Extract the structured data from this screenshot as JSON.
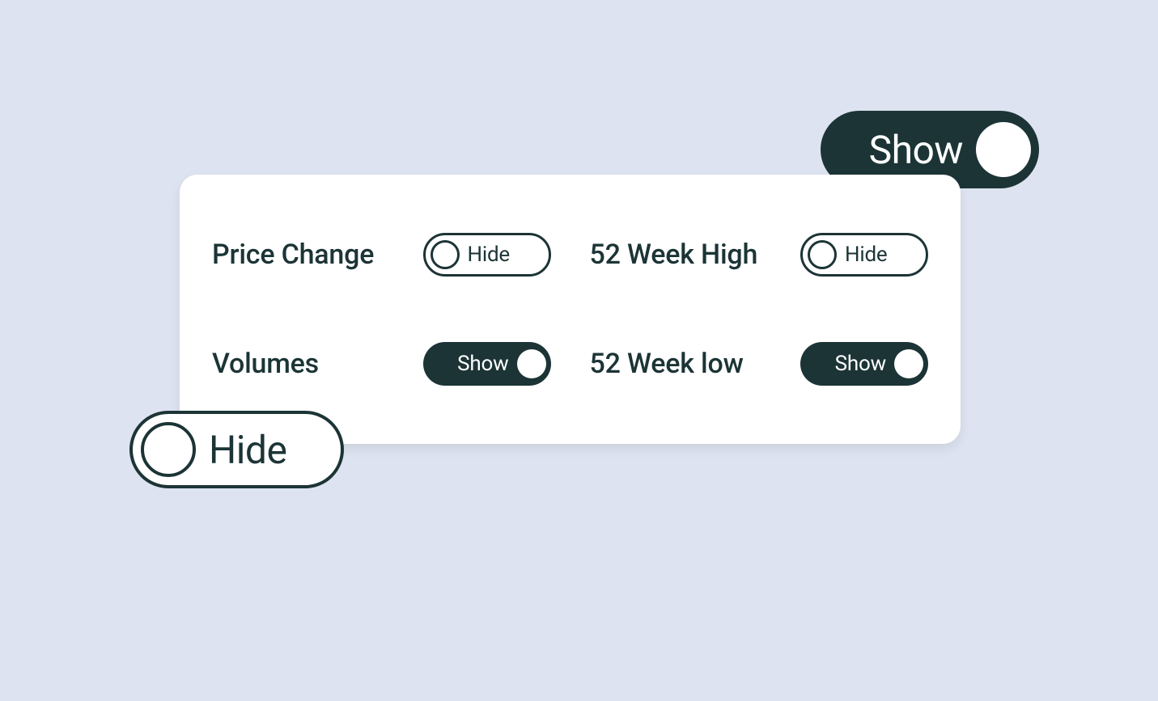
{
  "colors": {
    "background": "#dde3f0",
    "cardBackground": "#ffffff",
    "darkTeal": "#1c3436"
  },
  "floatingToggles": {
    "show": {
      "label": "Show",
      "state": "on"
    },
    "hide": {
      "label": "Hide",
      "state": "off"
    }
  },
  "settings": {
    "priceChange": {
      "label": "Price Change",
      "toggleLabel": "Hide",
      "state": "off"
    },
    "week52High": {
      "label": "52 Week High",
      "toggleLabel": "Hide",
      "state": "off"
    },
    "volumes": {
      "label": "Volumes",
      "toggleLabel": "Show",
      "state": "on"
    },
    "week52Low": {
      "label": "52 Week low",
      "toggleLabel": "Show",
      "state": "on"
    }
  }
}
